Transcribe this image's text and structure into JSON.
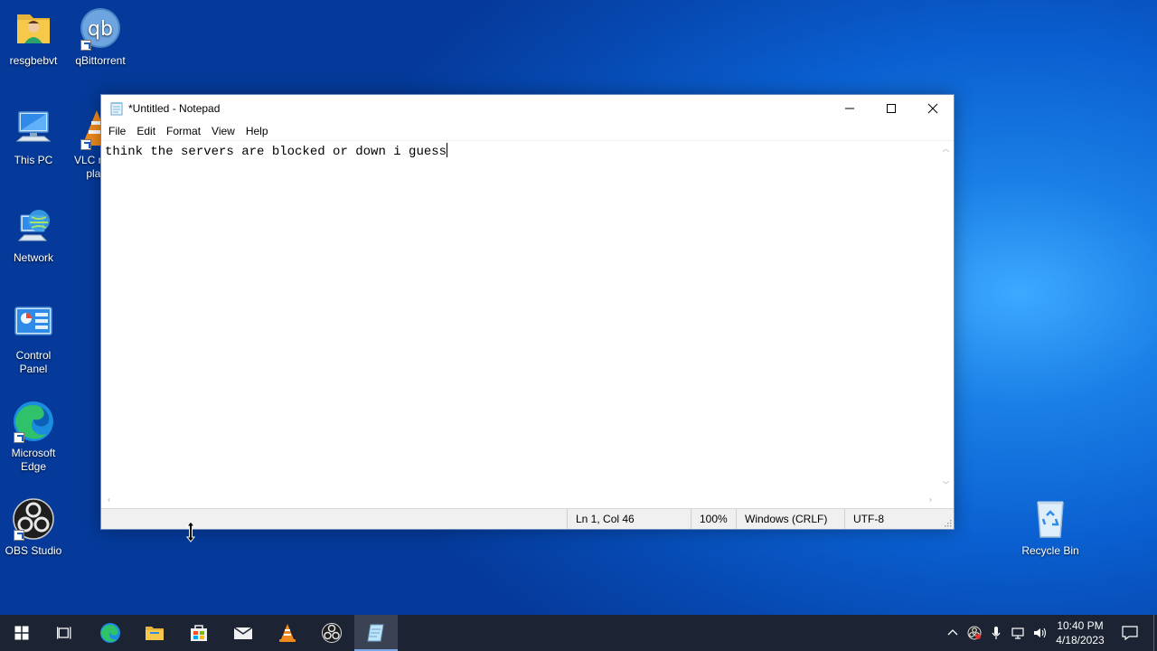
{
  "desktop": {
    "icons": [
      {
        "label": "resgbebvt"
      },
      {
        "label": "qBittorrent"
      },
      {
        "label": "This PC"
      },
      {
        "label": "VLC media player",
        "visible_label": "VLC r\npla"
      },
      {
        "label": "Network"
      },
      {
        "label": "Control Panel"
      },
      {
        "label": "Microsoft Edge"
      },
      {
        "label": "OBS Studio"
      },
      {
        "label": "Recycle Bin"
      }
    ]
  },
  "notepad": {
    "title": "*Untitled - Notepad",
    "menu": [
      "File",
      "Edit",
      "Format",
      "View",
      "Help"
    ],
    "content": "think the servers are blocked or down i guess",
    "status": {
      "position": "Ln 1, Col 46",
      "zoom": "100%",
      "line_ending": "Windows (CRLF)",
      "encoding": "UTF-8"
    }
  },
  "taskbar": {
    "clock_time": "10:40 PM",
    "clock_date": "4/18/2023",
    "accent": "#7aa7e6"
  }
}
